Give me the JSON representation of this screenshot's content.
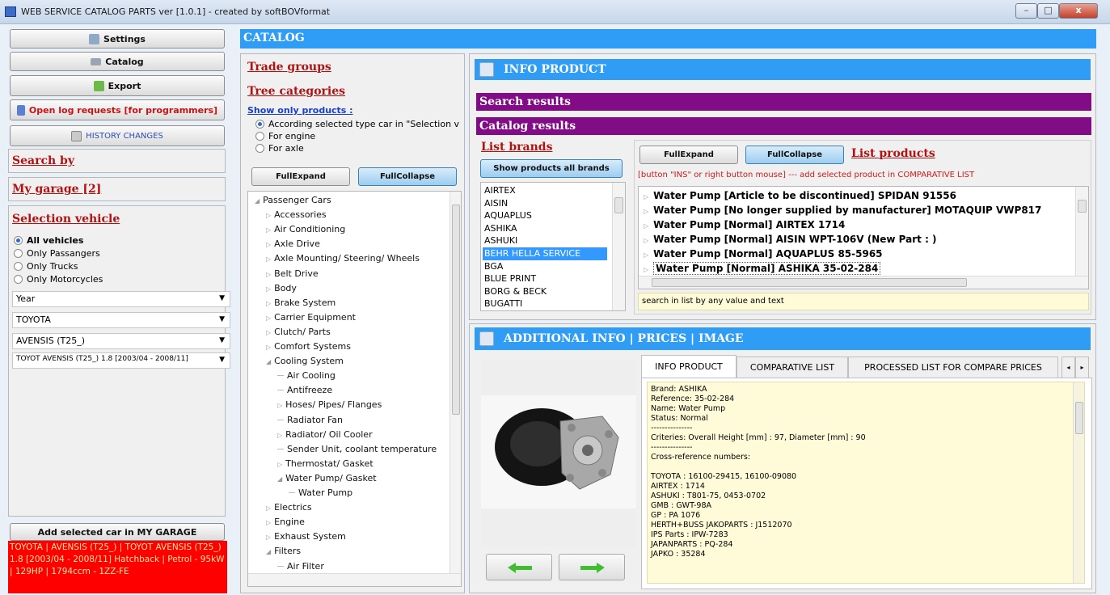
{
  "window": {
    "title": "WEB SERVICE CATALOG PARTS ver [1.0.1] - created by softBOVformat",
    "min": "–",
    "max": "□",
    "close": "x"
  },
  "sidebar": {
    "settings_label": "Settings",
    "catalog_label": "Catalog",
    "export_label": "Export",
    "log_label": "Open log requests [for programmers]",
    "history_label": "HISTORY CHANGES",
    "search_by": "Search by",
    "my_garage": "My garage [2]",
    "selection_vehicle": "Selection vehicle",
    "vehicle_types": [
      {
        "label": "All vehicles",
        "checked": true
      },
      {
        "label": "Only Passangers",
        "checked": false
      },
      {
        "label": "Only Trucks",
        "checked": false
      },
      {
        "label": "Only Motorcycles",
        "checked": false
      }
    ],
    "year": "Year",
    "make": "TOYOTA",
    "model": "AVENSIS (T25_)",
    "engine": "TOYOT AVENSIS (T25_) 1.8 [2003/04 - 2008/11]",
    "add_to_garage": "Add selected car in MY GARAGE",
    "selected_car": "TOYOTA | AVENSIS (T25_) | TOYOT AVENSIS (T25_) 1.8 [2003/04 - 2008/11] Hatchback | Petrol - 95kW | 129HP | 1794ccm - 1ZZ-FE"
  },
  "catalog": {
    "header": "CATALOG",
    "trade_groups": "Trade groups",
    "tree_categories": "Tree categories",
    "show_only_products": "Show only products :",
    "filter_options": [
      {
        "label": "According selected type car in \"Selection v",
        "checked": true
      },
      {
        "label": "For engine",
        "checked": false
      },
      {
        "label": "For axle",
        "checked": false
      }
    ],
    "full_expand": "FullExpand",
    "full_collapse": "FullCollapse",
    "tree": [
      {
        "label": "Passenger Cars",
        "level": 0,
        "marker": "◢"
      },
      {
        "label": "Accessories",
        "level": 1,
        "marker": "▷"
      },
      {
        "label": "Air Conditioning",
        "level": 1,
        "marker": "▷"
      },
      {
        "label": "Axle Drive",
        "level": 1,
        "marker": "▷"
      },
      {
        "label": "Axle Mounting/ Steering/ Wheels",
        "level": 1,
        "marker": "▷"
      },
      {
        "label": "Belt Drive",
        "level": 1,
        "marker": "▷"
      },
      {
        "label": "Body",
        "level": 1,
        "marker": "▷"
      },
      {
        "label": "Brake System",
        "level": 1,
        "marker": "▷"
      },
      {
        "label": "Carrier Equipment",
        "level": 1,
        "marker": "▷"
      },
      {
        "label": "Clutch/ Parts",
        "level": 1,
        "marker": "▷"
      },
      {
        "label": "Comfort Systems",
        "level": 1,
        "marker": "▷"
      },
      {
        "label": "Cooling System",
        "level": 1,
        "marker": "◢"
      },
      {
        "label": "Air Cooling",
        "level": 2,
        "marker": ""
      },
      {
        "label": "Antifreeze",
        "level": 2,
        "marker": ""
      },
      {
        "label": "Hoses/ Pipes/ Flanges",
        "level": 2,
        "marker": "▷"
      },
      {
        "label": "Radiator Fan",
        "level": 2,
        "marker": ""
      },
      {
        "label": "Radiator/ Oil Cooler",
        "level": 2,
        "marker": "▷"
      },
      {
        "label": "Sender Unit, coolant temperature",
        "level": 2,
        "marker": ""
      },
      {
        "label": "Thermostat/ Gasket",
        "level": 2,
        "marker": "▷"
      },
      {
        "label": "Water Pump/ Gasket",
        "level": 2,
        "marker": "◢"
      },
      {
        "label": "Water Pump",
        "level": 3,
        "marker": ""
      },
      {
        "label": "Electrics",
        "level": 1,
        "marker": "▷"
      },
      {
        "label": "Engine",
        "level": 1,
        "marker": "▷"
      },
      {
        "label": "Exhaust System",
        "level": 1,
        "marker": "▷"
      },
      {
        "label": "Filters",
        "level": 1,
        "marker": "◢"
      },
      {
        "label": "Air Filter",
        "level": 2,
        "marker": ""
      }
    ]
  },
  "info": {
    "header": "INFO PRODUCT",
    "search_results": "Search results",
    "catalog_results": "Catalog results",
    "list_brands": "List brands",
    "show_all_brands": "Show products all brands",
    "brands": [
      "AIRTEX",
      "AISIN",
      "AQUAPLUS",
      "ASHIKA",
      "ASHUKI",
      "BEHR HELLA SERVICE",
      "BGA",
      "BLUE PRINT",
      "BORG & BECK",
      "BUGATTI"
    ],
    "selected_brand": "BEHR HELLA SERVICE",
    "list_products": "List products",
    "hint": "[button \"INS\" or right button mouse] --- add selected product in COMPARATIVE LIST",
    "products": [
      "Water Pump [Article to be discontinued] SPIDAN 91556",
      "Water Pump [No longer supplied by manufacturer] MOTAQUIP VWP817",
      "Water Pump [Normal] AIRTEX 1714",
      "Water Pump [Normal] AISIN WPT-106V (New Part : )",
      "Water Pump [Normal] AQUAPLUS 85-5965",
      "Water Pump [Normal] ASHIKA 35-02-284"
    ],
    "search_placeholder": "search in list by any value and text"
  },
  "additional": {
    "header": "ADDITIONAL INFO | PRICES | IMAGE",
    "tabs": [
      "INFO PRODUCT",
      "COMPARATIVE LIST",
      "PROCESSED LIST FOR COMPARE PRICES"
    ],
    "details": [
      "Brand: ASHIKA",
      "Reference: 35-02-284",
      "Name: Water Pump",
      "Status: Normal",
      "---------------",
      "Criteries: Overall Height [mm] : 97, Diameter [mm] : 90",
      "---------------",
      "Cross-reference numbers:",
      "",
      "TOYOTA : 16100-29415, 16100-09080",
      "AIRTEX : 1714",
      "ASHUKI : T801-75, 0453-0702",
      "GMB : GWT-98A",
      "GP : PA 1076",
      "HERTH+BUSS JAKOPARTS : J1512070",
      "IPS Parts : IPW-7283",
      "JAPANPARTS : PQ-284",
      "JAPKO : 35284"
    ]
  },
  "colors": {
    "blue_bar": "#2f9cf5",
    "purple_bar": "#820c86",
    "link_red": "#b01212",
    "car_panel": "#ff0000",
    "arrow_green": "#3fbf2f"
  }
}
